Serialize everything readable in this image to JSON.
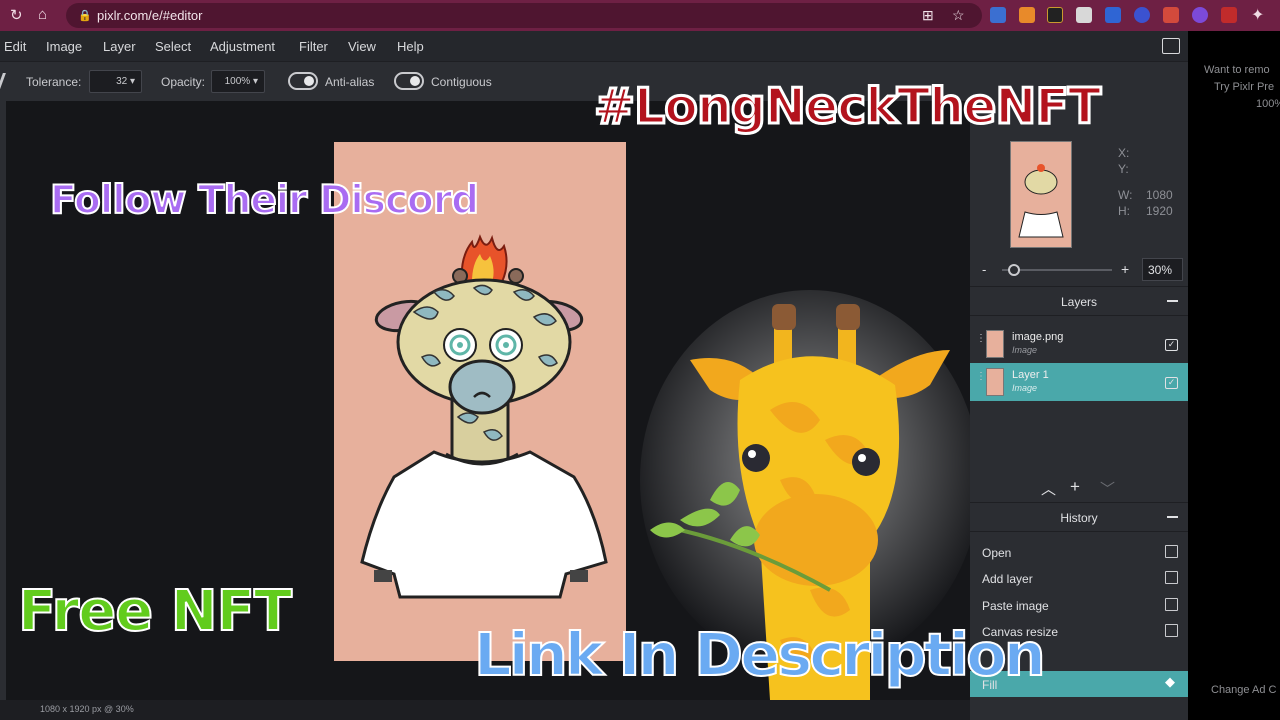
{
  "browser": {
    "url": "pixlr.com/e/#editor",
    "icons": [
      "reload-icon",
      "home-icon",
      "lock-icon",
      "install-icon",
      "star-icon",
      "extensions-icon"
    ]
  },
  "menu": [
    "Edit",
    "Image",
    "Layer",
    "Select",
    "Adjustment",
    "Filter",
    "View",
    "Help"
  ],
  "toolbar": {
    "tolerance_label": "Tolerance:",
    "tolerance_value": "32",
    "opacity_label": "Opacity:",
    "opacity_value": "100%",
    "antialias_label": "Anti-alias",
    "contiguous_label": "Contiguous"
  },
  "navigator": {
    "x_label": "X:",
    "y_label": "Y:",
    "w_label": "W:",
    "w_value": "1080",
    "h_label": "H:",
    "h_value": "1920",
    "zoom_minus": "-",
    "zoom_plus": "+",
    "zoom_value": "30%"
  },
  "layers": {
    "title": "Layers",
    "items": [
      {
        "name": "image.png",
        "type": "Image"
      },
      {
        "name": "Layer 1",
        "type": "Image"
      }
    ]
  },
  "history": {
    "title": "History",
    "items": [
      "Open",
      "Add layer",
      "Paste image",
      "Canvas resize",
      "Fill"
    ]
  },
  "status": {
    "text": "1080 x 1920 px @ 30%"
  },
  "ad_side": {
    "line1": "Want to remo",
    "line2": "Try Pixlr Pre",
    "line3": "100%",
    "bottom": "Change Ad C"
  },
  "overlay": {
    "top_right": "#LongNeckTheNFT",
    "top_left": "Follow Their Discord",
    "bottom_left": "Free NFT",
    "bottom": "Link In Description"
  },
  "colors": {
    "accent": "#4aa8aa",
    "browser": "#6e2044"
  }
}
